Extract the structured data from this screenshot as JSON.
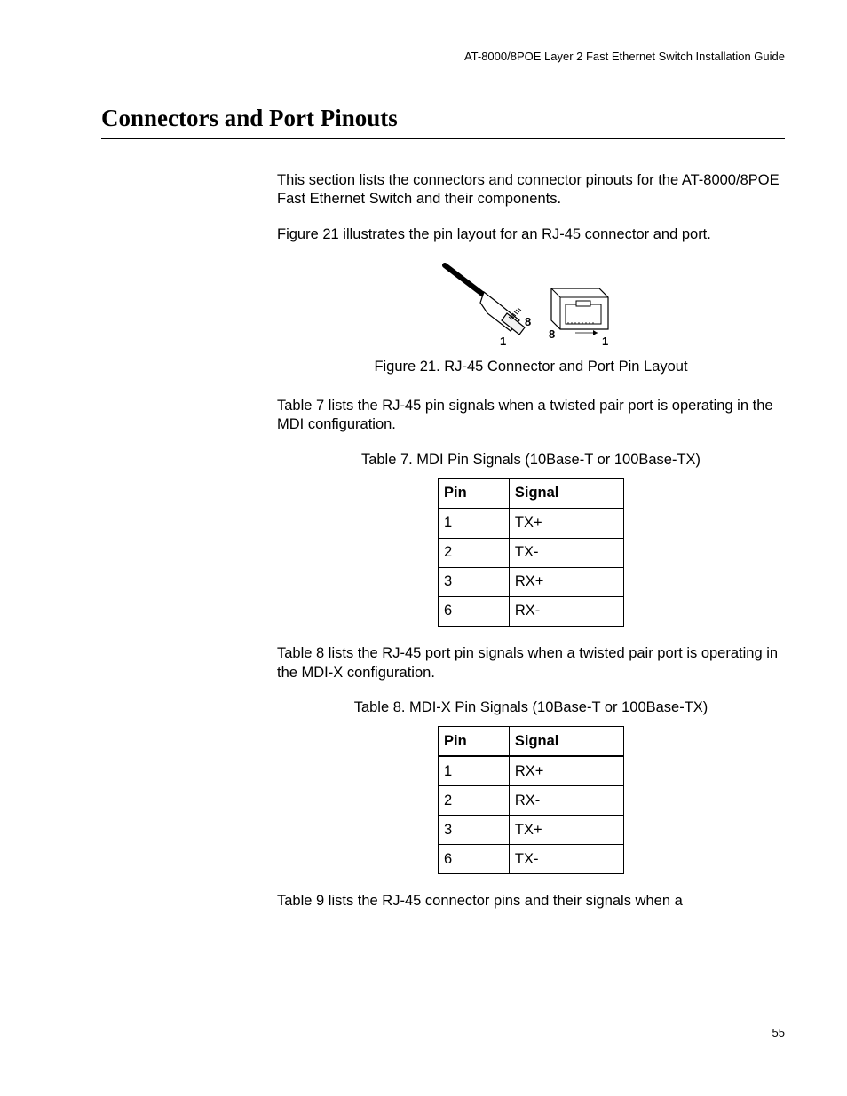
{
  "header": {
    "running_head": "AT-8000/8POE Layer 2 Fast Ethernet Switch Installation Guide"
  },
  "section": {
    "title": "Connectors and Port Pinouts"
  },
  "paragraphs": {
    "p1": "This section lists the connectors and connector pinouts for the AT-8000/8POE Fast Ethernet Switch and their components.",
    "p2": "Figure 21 illustrates the pin layout for an RJ-45 connector and port.",
    "p3": "Table 7 lists the RJ-45 pin signals when a twisted pair port is operating in the MDI configuration.",
    "p4": "Table 8 lists the RJ-45 port pin signals when a twisted pair port is operating in the MDI-X configuration.",
    "p5": "Table 9 lists the RJ-45 connector pins and their signals when a"
  },
  "figure": {
    "caption": "Figure 21.  RJ-45 Connector and Port Pin Layout",
    "left_label_1": "1",
    "left_label_8": "8",
    "right_label_8": "8",
    "right_label_1": "1"
  },
  "table7": {
    "caption": "Table 7.   MDI Pin Signals (10Base-T or 100Base-TX)",
    "col_pin": "Pin",
    "col_sig": "Signal",
    "rows": [
      {
        "pin": "1",
        "sig": "TX+"
      },
      {
        "pin": "2",
        "sig": "TX-"
      },
      {
        "pin": "3",
        "sig": "RX+"
      },
      {
        "pin": "6",
        "sig": "RX-"
      }
    ]
  },
  "table8": {
    "caption": "Table 8.   MDI-X Pin Signals (10Base-T or 100Base-TX)",
    "col_pin": "Pin",
    "col_sig": "Signal",
    "rows": [
      {
        "pin": "1",
        "sig": "RX+"
      },
      {
        "pin": "2",
        "sig": "RX-"
      },
      {
        "pin": "3",
        "sig": "TX+"
      },
      {
        "pin": "6",
        "sig": "TX-"
      }
    ]
  },
  "page_number": "55"
}
